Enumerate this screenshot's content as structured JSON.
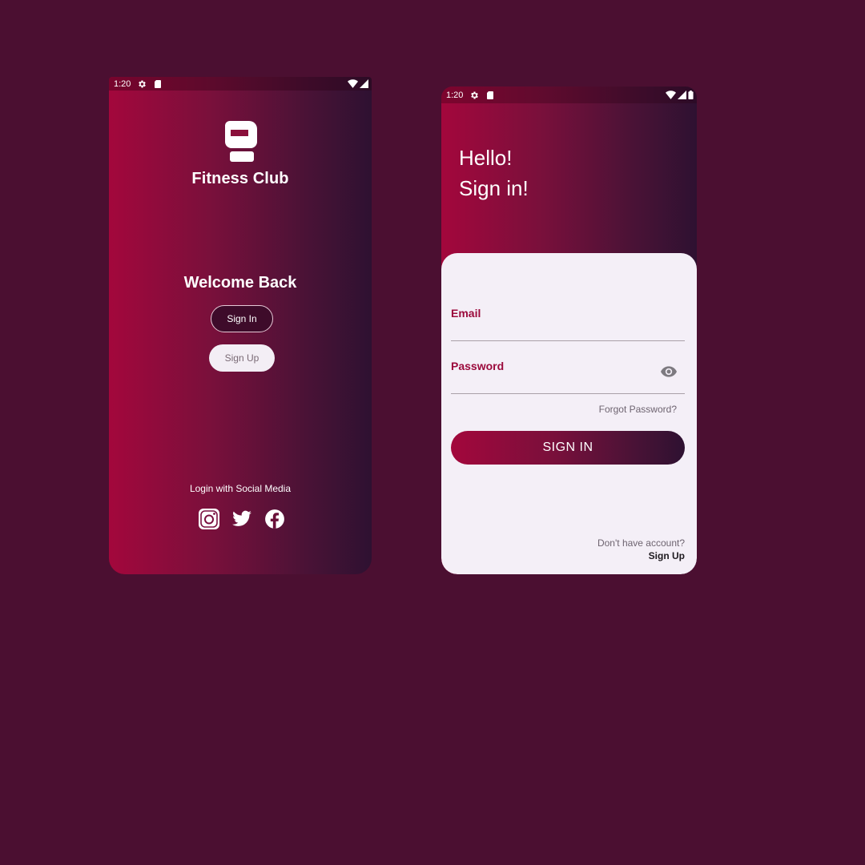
{
  "welcome_screen": {
    "status": {
      "time": "1:20"
    },
    "brand_name": "Fitness Club",
    "welcome_text": "Welcome Back",
    "sign_in_label": "Sign In",
    "sign_up_label": "Sign Up",
    "social_caption": "Login with Social Media",
    "social_icons": [
      "instagram-icon",
      "twitter-icon",
      "facebook-icon"
    ]
  },
  "signin_screen": {
    "status": {
      "time": "1:20"
    },
    "greeting_line1": "Hello!",
    "greeting_line2": "Sign in!",
    "email_label": "Email",
    "password_label": "Password",
    "forgot_password": "Forgot Password?",
    "sign_in_button": "SIGN IN",
    "no_account_text": "Don't have account?",
    "sign_up_link": "Sign Up"
  },
  "colors": {
    "background": "#4b0f31",
    "gradient_start": "#a3073c",
    "gradient_end": "#2e1131",
    "card": "#f4eff7",
    "accent": "#9b0a3c"
  }
}
